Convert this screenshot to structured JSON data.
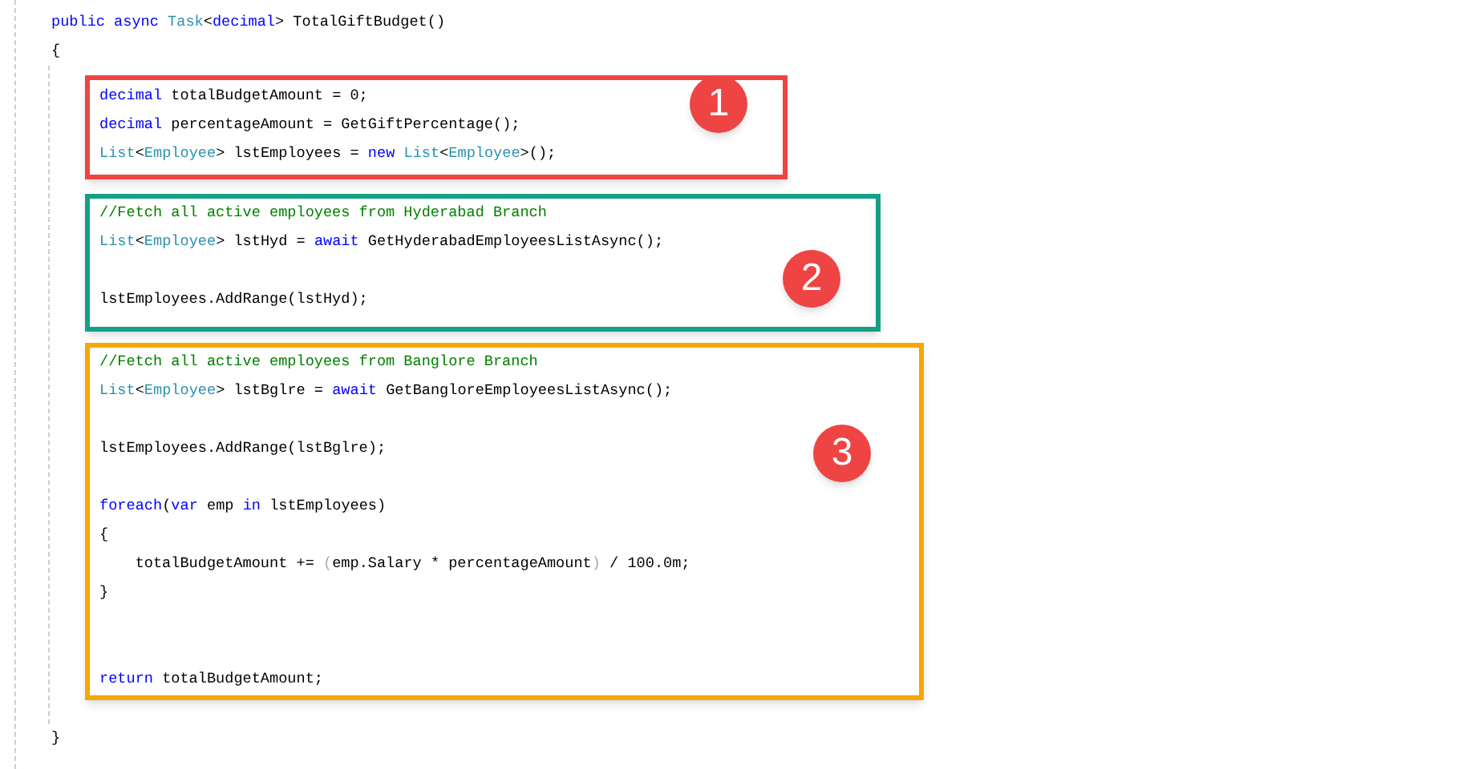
{
  "header": [
    {
      "kind": "code",
      "tokens": [
        {
          "kind": "keyword",
          "text": "public async "
        },
        {
          "kind": "type",
          "text": "Task"
        },
        {
          "kind": "plain",
          "text": "<"
        },
        {
          "kind": "keyword",
          "text": "decimal"
        },
        {
          "kind": "plain",
          "text": "> TotalGiftBudget()"
        }
      ]
    },
    {
      "kind": "code",
      "tokens": [
        {
          "kind": "plain",
          "text": "{"
        }
      ]
    }
  ],
  "blocks": [
    {
      "number": "1",
      "color": "#ef4444",
      "lines": [
        {
          "kind": "code",
          "tokens": [
            {
              "kind": "keyword",
              "text": "decimal"
            },
            {
              "kind": "plain",
              "text": " totalBudgetAmount = 0;"
            }
          ]
        },
        {
          "kind": "code",
          "tokens": [
            {
              "kind": "keyword",
              "text": "decimal"
            },
            {
              "kind": "plain",
              "text": " percentageAmount = GetGiftPercentage();"
            }
          ]
        },
        {
          "kind": "code",
          "tokens": [
            {
              "kind": "type",
              "text": "List"
            },
            {
              "kind": "plain",
              "text": "<"
            },
            {
              "kind": "type",
              "text": "Employee"
            },
            {
              "kind": "plain",
              "text": "> lstEmployees = "
            },
            {
              "kind": "keyword",
              "text": "new "
            },
            {
              "kind": "type",
              "text": "List"
            },
            {
              "kind": "plain",
              "text": "<"
            },
            {
              "kind": "type",
              "text": "Employee"
            },
            {
              "kind": "plain",
              "text": ">();"
            }
          ]
        }
      ]
    },
    {
      "number": "2",
      "color": "#14a085",
      "lines": [
        {
          "kind": "code",
          "tokens": [
            {
              "kind": "comment",
              "text": "//Fetch all active employees from Hyderabad Branch"
            }
          ]
        },
        {
          "kind": "code",
          "tokens": [
            {
              "kind": "type",
              "text": "List"
            },
            {
              "kind": "plain",
              "text": "<"
            },
            {
              "kind": "type",
              "text": "Employee"
            },
            {
              "kind": "plain",
              "text": "> lstHyd = "
            },
            {
              "kind": "keyword",
              "text": "await"
            },
            {
              "kind": "plain",
              "text": " GetHyderabadEmployeesListAsync();"
            }
          ]
        },
        {
          "kind": "blank"
        },
        {
          "kind": "code",
          "tokens": [
            {
              "kind": "plain",
              "text": "lstEmployees.AddRange(lstHyd);"
            }
          ]
        }
      ]
    },
    {
      "number": "3",
      "color": "#f5a800",
      "lines": [
        {
          "kind": "code",
          "tokens": [
            {
              "kind": "comment",
              "text": "//Fetch all active employees from Banglore Branch"
            }
          ]
        },
        {
          "kind": "code",
          "tokens": [
            {
              "kind": "type",
              "text": "List"
            },
            {
              "kind": "plain",
              "text": "<"
            },
            {
              "kind": "type",
              "text": "Employee"
            },
            {
              "kind": "plain",
              "text": "> lstBglre = "
            },
            {
              "kind": "keyword",
              "text": "await"
            },
            {
              "kind": "plain",
              "text": " GetBangloreEmployeesListAsync();"
            }
          ]
        },
        {
          "kind": "blank"
        },
        {
          "kind": "code",
          "tokens": [
            {
              "kind": "plain",
              "text": "lstEmployees.AddRange(lstBglre);"
            }
          ]
        },
        {
          "kind": "blank"
        },
        {
          "kind": "code",
          "tokens": [
            {
              "kind": "keyword",
              "text": "foreach"
            },
            {
              "kind": "plain",
              "text": "("
            },
            {
              "kind": "keyword",
              "text": "var"
            },
            {
              "kind": "plain",
              "text": " emp "
            },
            {
              "kind": "keyword",
              "text": "in"
            },
            {
              "kind": "plain",
              "text": " lstEmployees)"
            }
          ]
        },
        {
          "kind": "code",
          "tokens": [
            {
              "kind": "plain",
              "text": "{"
            }
          ]
        },
        {
          "kind": "code",
          "tokens": [
            {
              "kind": "plain",
              "text": "    totalBudgetAmount += "
            },
            {
              "kind": "dim",
              "text": "("
            },
            {
              "kind": "plain",
              "text": "emp.Salary * percentageAmount"
            },
            {
              "kind": "dim",
              "text": ")"
            },
            {
              "kind": "plain",
              "text": " / 100.0m;"
            }
          ]
        },
        {
          "kind": "code",
          "tokens": [
            {
              "kind": "plain",
              "text": "}"
            }
          ]
        },
        {
          "kind": "blank"
        },
        {
          "kind": "blank"
        },
        {
          "kind": "code",
          "tokens": [
            {
              "kind": "keyword",
              "text": "return"
            },
            {
              "kind": "plain",
              "text": " totalBudgetAmount;"
            }
          ]
        }
      ]
    }
  ],
  "footer": [
    {
      "kind": "code",
      "tokens": [
        {
          "kind": "plain",
          "text": "}"
        }
      ]
    }
  ]
}
